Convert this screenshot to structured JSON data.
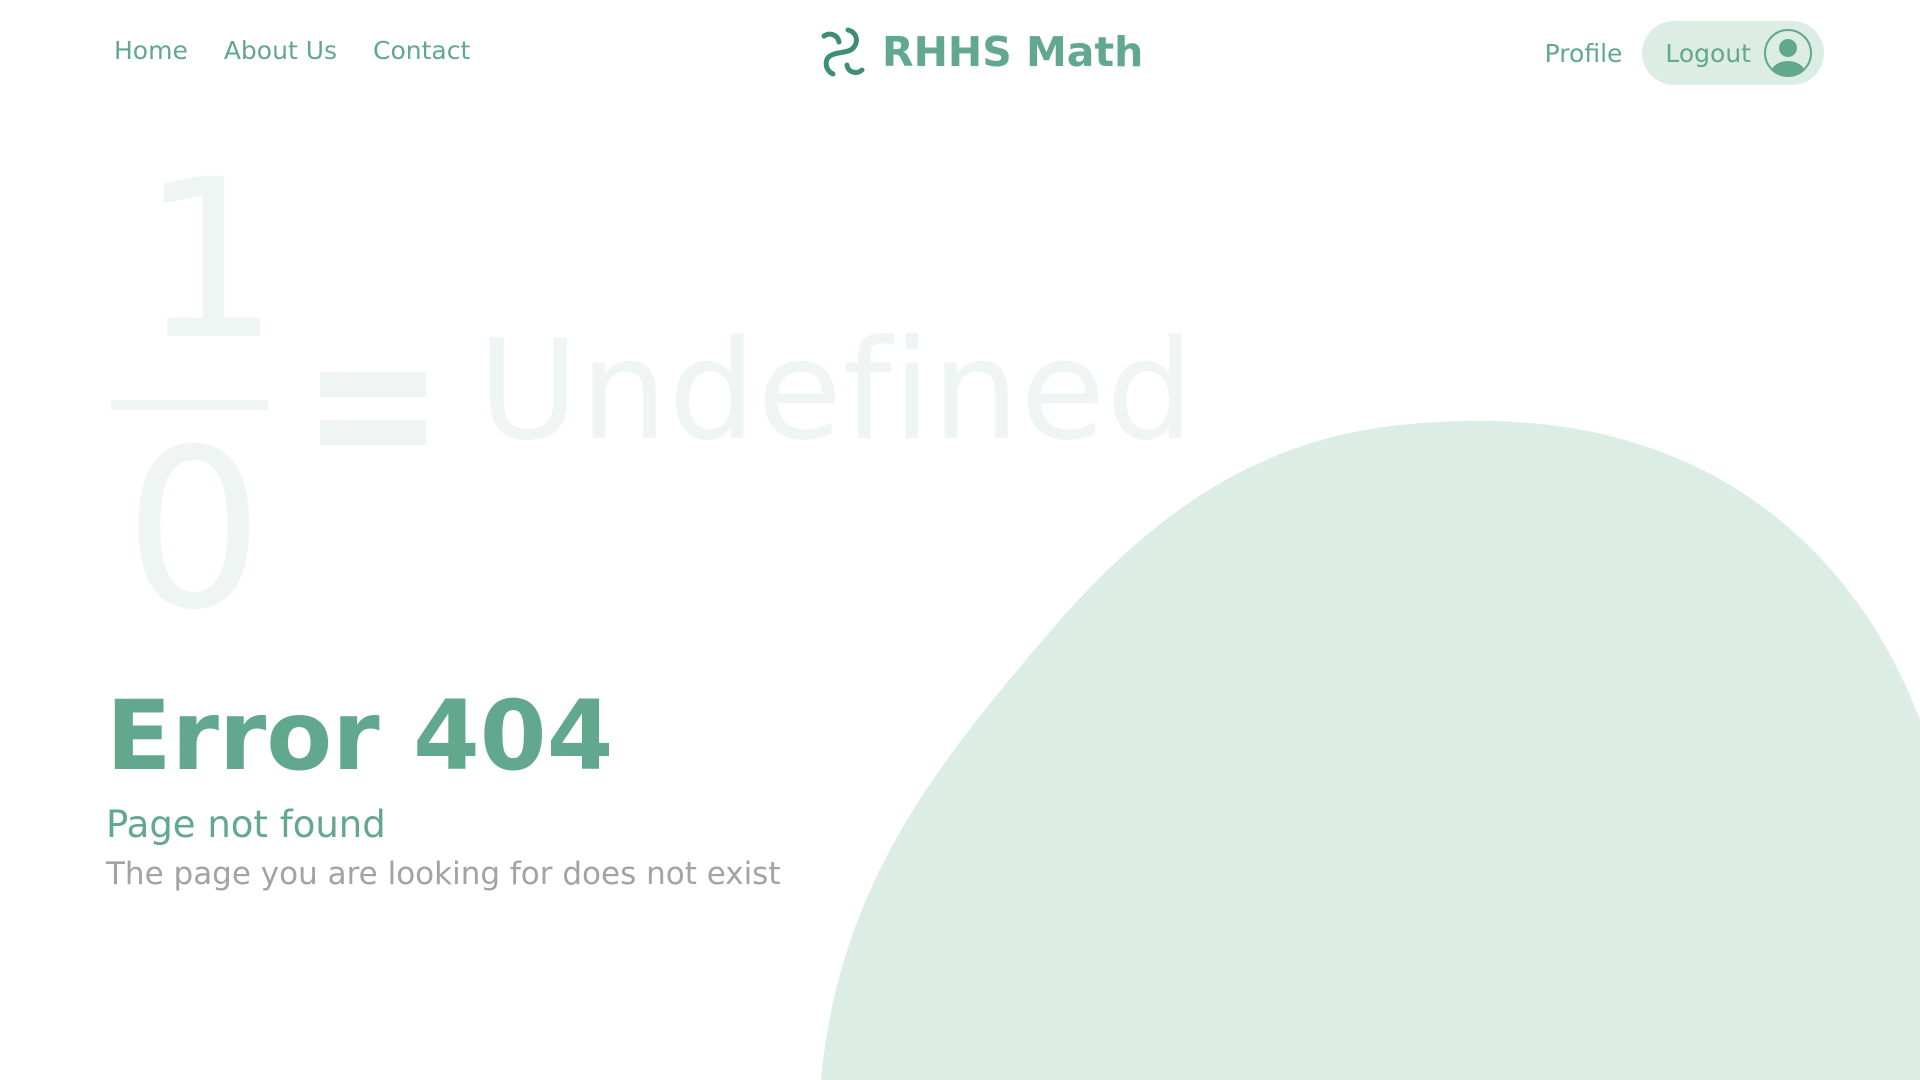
{
  "nav": {
    "links": [
      {
        "label": "Home"
      },
      {
        "label": "About Us"
      },
      {
        "label": "Contact"
      }
    ],
    "brand": "RHHS Math",
    "profile_label": "Profile",
    "logout_label": "Logout"
  },
  "background": {
    "numerator": "1",
    "denominator": "0",
    "result": "Undefined"
  },
  "error": {
    "title": "Error 404",
    "subtitle": "Page not found",
    "message": "The page you are looking for does not exist"
  },
  "colors": {
    "accent": "#62a88e",
    "accent_dark": "#3d8f74",
    "pill_bg": "#dcede6",
    "blob": "#dcede6",
    "faint_text": "#eef5f2",
    "muted_text": "#a3a3a3"
  },
  "icons": {
    "brand": "swirl-logo-icon",
    "avatar": "user-avatar-icon"
  }
}
